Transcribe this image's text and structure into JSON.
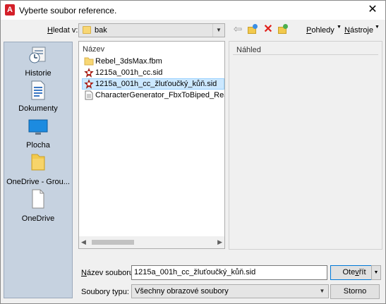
{
  "window": {
    "title": "Vyberte soubor reference.",
    "app_icon": "A",
    "close_glyph": "✕"
  },
  "toolbar": {
    "look_in_label_u": "H",
    "look_in_label_rest": "ledat v:",
    "look_in_value": "bak",
    "views_label_u": "P",
    "views_label_rest": "ohledy",
    "tools_label_u": "N",
    "tools_label_rest": "ástroje"
  },
  "places": [
    {
      "label": "Historie",
      "icon": "history-icon"
    },
    {
      "label": "Dokumenty",
      "icon": "documents-icon"
    },
    {
      "label": "Plocha",
      "icon": "desktop-icon"
    },
    {
      "label": "OneDrive - Grou...",
      "icon": "onedrive-group-icon"
    },
    {
      "label": "OneDrive",
      "icon": "onedrive-icon"
    }
  ],
  "file_list": {
    "column_header": "Název",
    "files": [
      {
        "name": "Rebel_3dsMax.fbm",
        "icon": "folder-icon",
        "selected": false
      },
      {
        "name": "1215a_001h_cc.sid",
        "icon": "sid-file-icon",
        "selected": false
      },
      {
        "name": "1215a_001h_cc_žluťoučký_kůň.sid",
        "icon": "sid-file-icon",
        "selected": true
      },
      {
        "name": "CharacterGenerator_FbxToBiped_Readme",
        "icon": "text-file-icon",
        "selected": false
      }
    ]
  },
  "preview": {
    "label": "Náhled"
  },
  "footer": {
    "file_name_label_u": "N",
    "file_name_label_rest": "ázev souboru:",
    "file_name_value": "1215a_001h_cc_žluťoučký_kůň.sid",
    "file_type_label": "Soubory typu:",
    "file_type_value": "Všechny obrazové soubory",
    "open_label_pre": "Ote",
    "open_label_u": "v",
    "open_label_post": "řít",
    "cancel_label": "Storno"
  },
  "colors": {
    "accent": "#0078d7",
    "selection": "#cce8ff",
    "places_bg": "#c6d2e0",
    "delete": "#e0201a",
    "app_icon": "#d4202a"
  }
}
